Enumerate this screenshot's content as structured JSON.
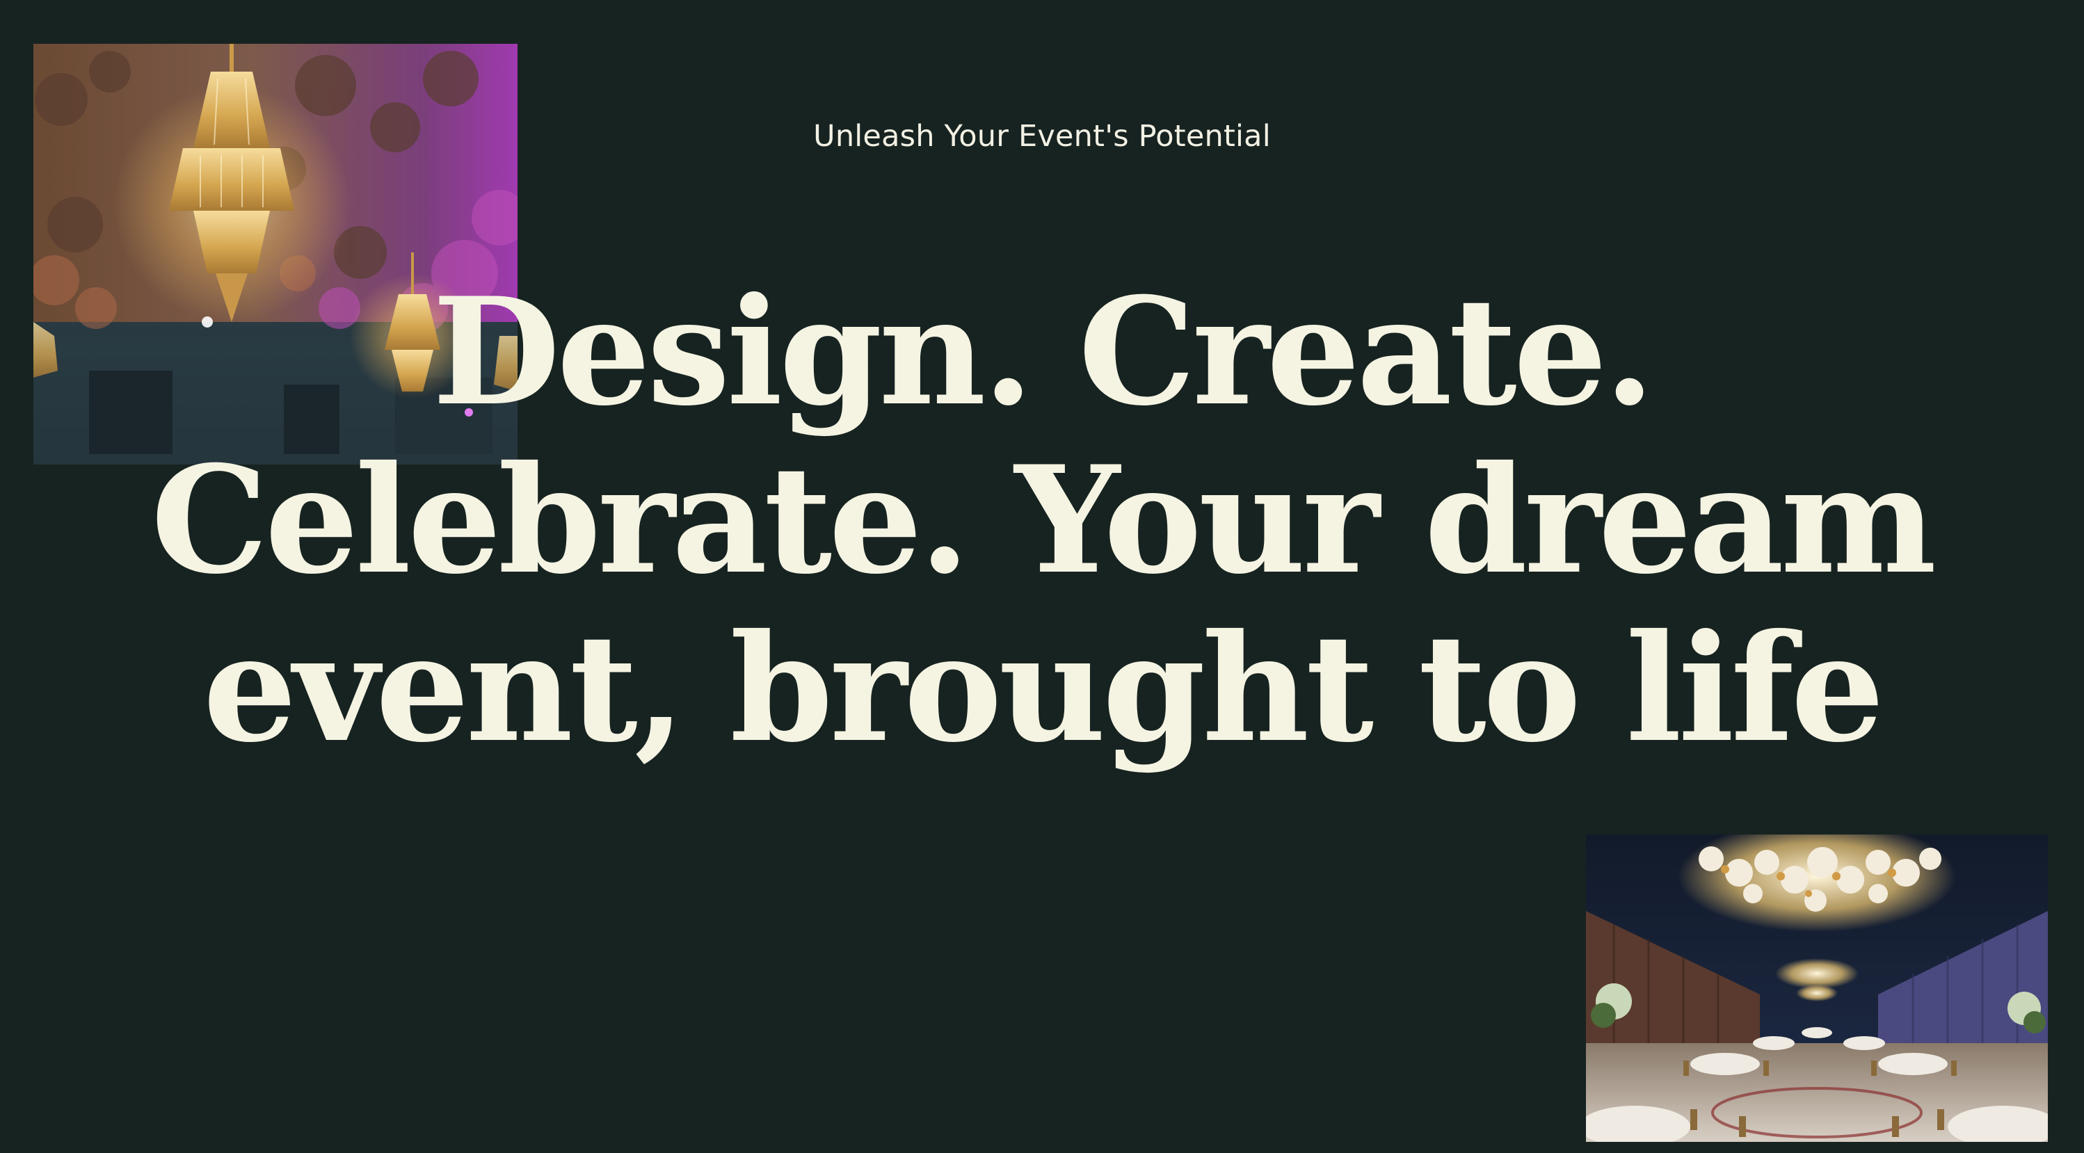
{
  "hero": {
    "eyebrow": "Unleash Your Event's Potential",
    "headline_lines": [
      "Design. Create.",
      "Celebrate. Your dream",
      "event, brought to life"
    ]
  },
  "images": {
    "top_left": "chandelier-floral-ceiling-photo",
    "bottom_right": "ballroom-banquet-photo"
  },
  "colors": {
    "background": "#172321",
    "headline": "#f5f4e3",
    "eyebrow": "#f2f1e4"
  }
}
